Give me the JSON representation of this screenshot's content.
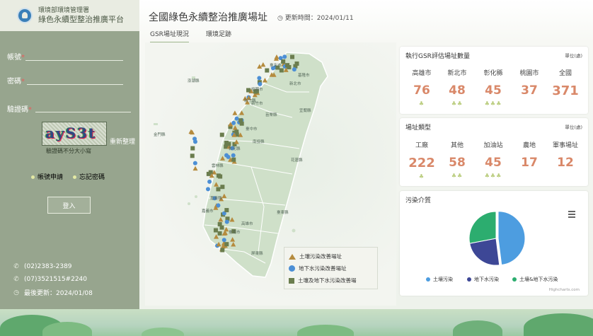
{
  "sidebar": {
    "agency": "環境部環境管理署",
    "platform": "綠色永續型整治推廣平台",
    "account_label": "帳號",
    "password_label": "密碼",
    "captcha_label": "驗證碼",
    "captcha_text": "ayS3t",
    "refresh_label": "重新整理",
    "captcha_note": "驗證碼不分大小寫",
    "apply_link": "帳號申請",
    "forgot_link": "忘記密碼",
    "login_button": "登入",
    "phone1": "(02)2383-2389",
    "phone2": "(07)3521515#2240",
    "last_updated": "最後更新：2024/01/08"
  },
  "header": {
    "title": "全國綠色永續整治推廣場址",
    "updated": "更新時間：2024/01/11",
    "tabs": [
      "GSR場址現況",
      "環境足跡"
    ]
  },
  "map": {
    "regions": [
      "基隆市",
      "臺北市",
      "新北市",
      "桃園市",
      "新竹縣",
      "新竹市",
      "苗栗縣",
      "臺中市",
      "彰化縣",
      "南投縣",
      "雲林縣",
      "嘉義縣",
      "嘉義市",
      "臺南市",
      "高雄市",
      "屏東縣",
      "宜蘭縣",
      "花蓮縣",
      "臺東縣",
      "澎湖縣",
      "金門縣",
      "連江縣"
    ],
    "legend": [
      "土壤污染改善場址",
      "地下水污染改善場址",
      "土壤及地下水污染改善場"
    ]
  },
  "card_sites": {
    "title": "執行GSR評估場址數量",
    "unit": "單位(處)",
    "items": [
      {
        "label": "高雄市",
        "value": "76",
        "sprouts": "♣"
      },
      {
        "label": "新北市",
        "value": "48",
        "sprouts": "♣♣"
      },
      {
        "label": "彰化縣",
        "value": "45",
        "sprouts": "♣♣♣"
      },
      {
        "label": "桃園市",
        "value": "37",
        "sprouts": ""
      },
      {
        "label": "全國",
        "value": "371",
        "sprouts": ""
      }
    ]
  },
  "card_types": {
    "title": "場址類型",
    "unit": "單位(處)",
    "items": [
      {
        "label": "工廠",
        "value": "222",
        "sprouts": "♣"
      },
      {
        "label": "其他",
        "value": "58",
        "sprouts": "♣♣"
      },
      {
        "label": "加油站",
        "value": "45",
        "sprouts": "♣♣♣"
      },
      {
        "label": "農地",
        "value": "17",
        "sprouts": ""
      },
      {
        "label": "軍事場址",
        "value": "12",
        "sprouts": ""
      }
    ]
  },
  "card_media": {
    "title": "污染介質",
    "credit": "Highcharts.com",
    "legend": [
      "土壤污染",
      "地下水污染",
      "土壤&地下水污染"
    ]
  },
  "chart_data": {
    "type": "pie",
    "categories": [
      "土壤污染",
      "地下水污染",
      "土壤&地下水污染"
    ],
    "values": [
      48,
      24,
      28
    ],
    "colors": [
      "#4d9de0",
      "#3d4796",
      "#2cad6f"
    ]
  }
}
